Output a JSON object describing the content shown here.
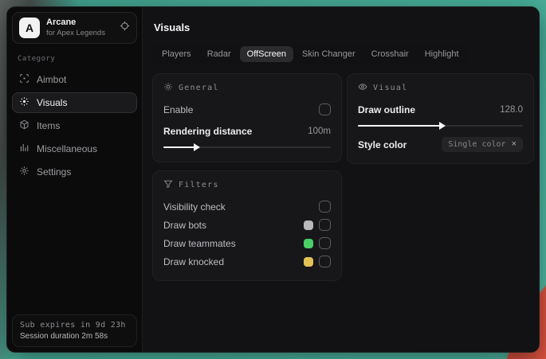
{
  "app": {
    "logo_letter": "A",
    "name": "Arcane",
    "subtitle": "for Apex Legends"
  },
  "sidebar": {
    "category_label": "Category",
    "items": [
      {
        "label": "Aimbot"
      },
      {
        "label": "Visuals"
      },
      {
        "label": "Items"
      },
      {
        "label": "Miscellaneous"
      },
      {
        "label": "Settings"
      }
    ],
    "footer": {
      "sub_expires": "Sub expires in 9d 23h",
      "session_duration": "Session duration 2m 58s"
    }
  },
  "main": {
    "title": "Visuals",
    "active_tab": "OffScreen",
    "tabs": [
      {
        "label": "Players"
      },
      {
        "label": "Radar"
      },
      {
        "label": "OffScreen"
      },
      {
        "label": "Skin Changer"
      },
      {
        "label": "Crosshair"
      },
      {
        "label": "Highlight"
      }
    ]
  },
  "panels": {
    "general": {
      "title": "General",
      "enable_label": "Enable",
      "enable_checked": false,
      "rendering_distance_label": "Rendering distance",
      "rendering_distance_value": "100m",
      "rendering_distance_percent": "19%"
    },
    "visual": {
      "title": "Visual",
      "draw_outline_label": "Draw outline",
      "draw_outline_value": "128.0",
      "draw_outline_percent": "50%",
      "style_color_label": "Style color",
      "style_color_selected": "Single color",
      "style_color_clear_glyph": "×"
    },
    "filters": {
      "title": "Filters",
      "rows": [
        {
          "label": "Visibility check",
          "checked": false
        },
        {
          "label": "Draw bots",
          "swatch": "#b9b9b9",
          "checked": false
        },
        {
          "label": "Draw teammates",
          "swatch": "#4ad066",
          "checked": false
        },
        {
          "label": "Draw knocked",
          "swatch": "#e2c255",
          "checked": false
        }
      ]
    }
  },
  "colors": {
    "desktop_teal": "#4bb7a0",
    "desktop_orange": "#df5340",
    "window_bg": "#0c0c0d",
    "panel_bg": "#17171a"
  }
}
